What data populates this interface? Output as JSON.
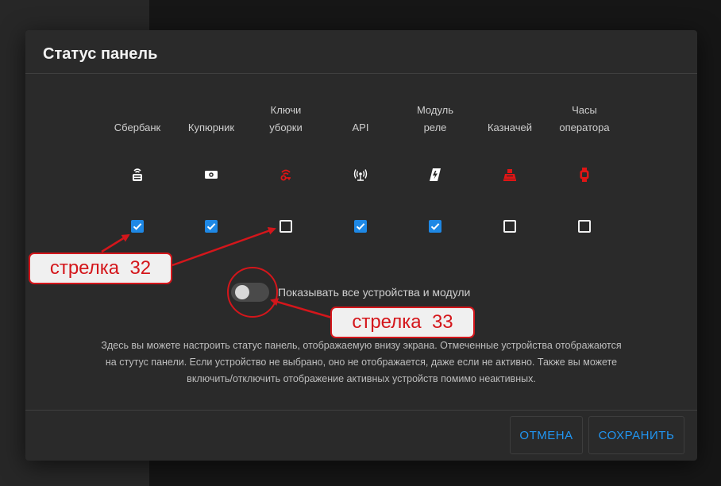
{
  "dialog": {
    "title": "Статус панель",
    "columns": [
      {
        "label": "Сбербанк",
        "icon": "pos-terminal-icon",
        "checked": true,
        "icon_color": "#ffffff"
      },
      {
        "label": "Купюрник",
        "icon": "banknote-icon",
        "checked": true,
        "icon_color": "#ffffff"
      },
      {
        "label": "Ключи\nуборки",
        "icon": "key-icon",
        "checked": false,
        "icon_color": "#e01515"
      },
      {
        "label": "API",
        "icon": "broadcast-icon",
        "checked": true,
        "icon_color": "#ffffff"
      },
      {
        "label": "Модуль\nреле",
        "icon": "relay-icon",
        "checked": true,
        "icon_color": "#ffffff"
      },
      {
        "label": "Казначей",
        "icon": "cash-register-icon",
        "checked": false,
        "icon_color": "#e01515"
      },
      {
        "label": "Часы\nоператора",
        "icon": "watch-icon",
        "checked": false,
        "icon_color": "#e01515"
      }
    ],
    "toggle": {
      "label": "Показывать все устройства и модули",
      "on": false
    },
    "help": [
      "Здесь вы можете настроить статус панель, отображаемую внизу экрана. Отмеченные устройства отображаются",
      "на стутус панели. Если устройство не выбрано, оно не отображается, даже если не активно. Также вы можете",
      "включить/отключить отображение активных устройств помимо неактивных."
    ],
    "buttons": {
      "cancel": "ОТМЕНА",
      "save": "СОХРАНИТЬ"
    }
  },
  "annotations": {
    "callout_32": "стрелка  32",
    "callout_33": "стрелка  33",
    "color": "#d4161b"
  },
  "colors": {
    "accent": "#1e88e5",
    "button_text": "#2196f3"
  }
}
